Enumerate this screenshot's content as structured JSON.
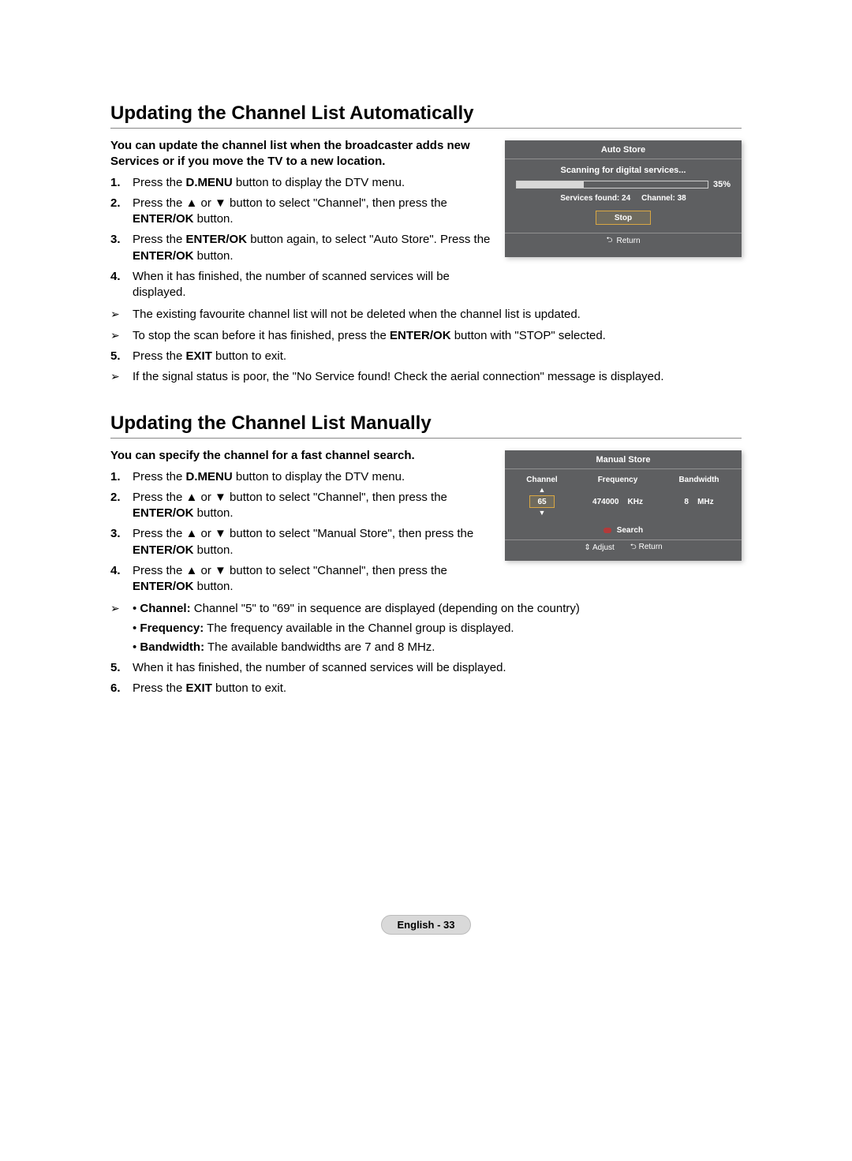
{
  "section1": {
    "title": "Updating the Channel List Automatically",
    "intro": "You can update the channel list when the broadcaster adds new Services or if you move the TV to a new location.",
    "steps": {
      "s1_num": "1.",
      "s1": "Press the <b>D.MENU</b> button to display the DTV menu.",
      "s2_num": "2.",
      "s2": "Press the ▲ or ▼ button to select \"Channel\", then press the <b>ENTER/OK</b> button.",
      "s3_num": "3.",
      "s3": "Press the <b>ENTER/OK</b> button again, to select \"Auto Store\". Press the <b>ENTER/OK</b> button.",
      "s4_num": "4.",
      "s4": "When it has finished, the number of scanned services will be displayed.",
      "n1_icon": "➢",
      "n1": "The existing favourite channel list will not be deleted when the channel list is updated.",
      "n2_icon": "➢",
      "n2": "To stop the scan before it has finished, press the <b>ENTER/OK</b> button with \"STOP\" selected.",
      "s5_num": "5.",
      "s5": "Press the <b>EXIT</b> button to exit.",
      "n3_icon": "➢",
      "n3": "If the signal status is poor, the \"No Service found! Check the aerial connection\" message is displayed."
    }
  },
  "osd_auto": {
    "title": "Auto Store",
    "scanning": "Scanning for digital services...",
    "percent": "35%",
    "percent_value": 35,
    "services_found": "Services found: 24",
    "channel": "Channel: 38",
    "stop": "Stop",
    "return_icon": "⮌",
    "return": "Return"
  },
  "section2": {
    "title": "Updating the Channel List Manually",
    "intro": "You can specify the channel for a fast channel search.",
    "steps": {
      "s1_num": "1.",
      "s1": "Press the <b>D.MENU</b> button to display the DTV menu.",
      "s2_num": "2.",
      "s2": "Press the ▲ or ▼ button to select \"Channel\", then press the <b>ENTER/OK</b> button.",
      "s3_num": "3.",
      "s3": "Press the ▲ or ▼ button to select \"Manual Store\", then press the <b>ENTER/OK</b> button.",
      "s4_num": "4.",
      "s4": "Press the ▲ or ▼ button to select \"Channel\", then press the <b>ENTER/OK</b> button.",
      "n1_icon": "➢",
      "b1": "• <b>Channel:</b> Channel \"5\" to \"69\" in sequence are displayed (depending on the country)",
      "b2": "• <b>Frequency:</b> The frequency available in the Channel group is displayed.",
      "b3": "• <b>Bandwidth:</b> The available bandwidths are 7 and 8 MHz.",
      "s5_num": "5.",
      "s5": "When it has finished, the number of scanned services will be displayed.",
      "s6_num": "6.",
      "s6": "Press the <b>EXIT</b> button to exit."
    }
  },
  "osd_manual": {
    "title": "Manual Store",
    "h_channel": "Channel",
    "h_frequency": "Frequency",
    "h_bandwidth": "Bandwidth",
    "up": "▲",
    "down": "▼",
    "ch_value": "65",
    "freq_value": "474000",
    "khz": "KHz",
    "bw_value": "8",
    "mhz": "MHz",
    "search": "Search",
    "adjust_icon": "⇕",
    "adjust": "Adjust",
    "return_icon": "⮌",
    "return": "Return"
  },
  "footer": "English - 33"
}
